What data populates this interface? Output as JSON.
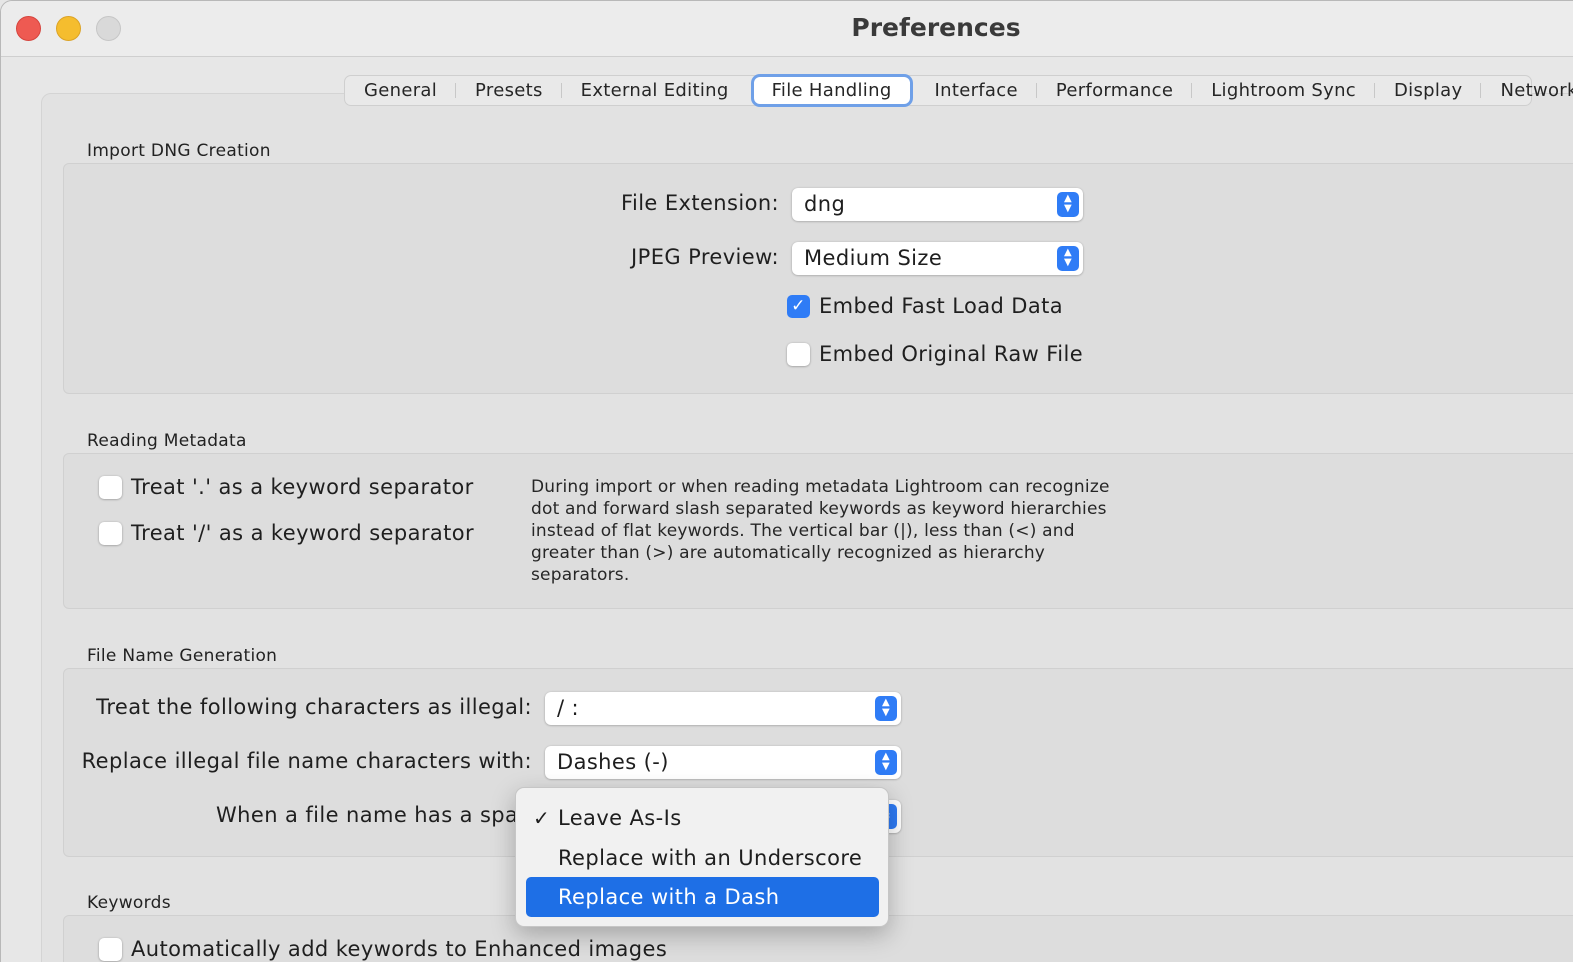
{
  "window": {
    "title": "Preferences"
  },
  "tabs": [
    {
      "label": "General"
    },
    {
      "label": "Presets"
    },
    {
      "label": "External Editing"
    },
    {
      "label": "File Handling"
    },
    {
      "label": "Interface"
    },
    {
      "label": "Performance"
    },
    {
      "label": "Lightroom Sync"
    },
    {
      "label": "Display"
    },
    {
      "label": "Network"
    }
  ],
  "active_tab": "File Handling",
  "import_dng": {
    "title": "Import DNG Creation",
    "file_extension_label": "File Extension:",
    "file_extension_value": "dng",
    "jpeg_preview_label": "JPEG Preview:",
    "jpeg_preview_value": "Medium Size",
    "embed_fast_load_label": "Embed Fast Load Data",
    "embed_fast_load_checked": true,
    "embed_raw_label": "Embed Original Raw File",
    "embed_raw_checked": false
  },
  "reading_metadata": {
    "title": "Reading Metadata",
    "dot_separator_label": "Treat '.' as a keyword separator",
    "slash_separator_label": "Treat '/' as a keyword separator",
    "description": "During import or when reading metadata Lightroom can recognize dot and forward slash separated keywords as keyword hierarchies instead of flat keywords. The vertical bar (|), less than (<) and greater than (>) are automatically recognized as hierarchy separators."
  },
  "file_name_generation": {
    "title": "File Name Generation",
    "illegal_label": "Treat the following characters as illegal:",
    "illegal_value": "/ :",
    "replace_label": "Replace illegal file name characters with:",
    "replace_value": "Dashes (-)",
    "space_label": "When a file name has a spac"
  },
  "space_menu": {
    "items": [
      {
        "label": "Leave As-Is",
        "checked": true
      },
      {
        "label": "Replace with an Underscore"
      },
      {
        "label": "Replace with a Dash",
        "highlighted": true
      }
    ]
  },
  "keywords": {
    "title": "Keywords",
    "auto_add_label": "Automatically add keywords to Enhanced images"
  },
  "colors": {
    "accent": "#2f7cf6",
    "menu_highlight": "#1e6fe6"
  }
}
